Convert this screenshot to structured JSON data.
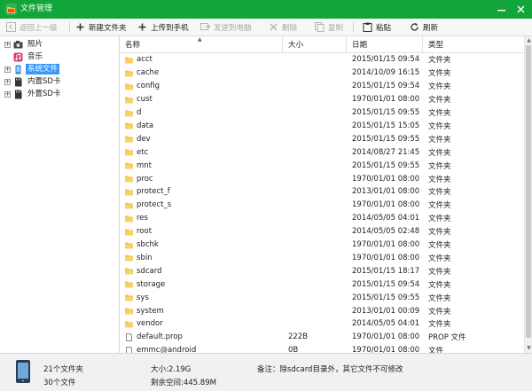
{
  "window": {
    "title": "文件管理",
    "accent": "#12a53a",
    "controls": [
      "minimize",
      "close"
    ]
  },
  "toolbar": {
    "back": {
      "label": "返回上一级",
      "icon": "back-icon",
      "enabled": false
    },
    "new_folder": {
      "label": "新建文件夹",
      "icon": "plus-icon",
      "enabled": true
    },
    "upload": {
      "label": "上传到手机",
      "icon": "plus-icon",
      "enabled": true
    },
    "send_pc": {
      "label": "发送到电脑",
      "icon": "send-icon",
      "enabled": false
    },
    "delete": {
      "label": "删除",
      "icon": "close-icon",
      "enabled": false
    },
    "copy": {
      "label": "复制",
      "icon": "copy-icon",
      "enabled": false
    },
    "paste": {
      "label": "粘贴",
      "icon": "clipboard-icon",
      "enabled": true
    },
    "refresh": {
      "label": "刷新",
      "icon": "refresh-icon",
      "enabled": true
    }
  },
  "tree": [
    {
      "label": "照片",
      "icon": "camera-icon",
      "expander": true
    },
    {
      "label": "音乐",
      "icon": "music-icon",
      "expander": false
    },
    {
      "label": "系统文件",
      "icon": "phone-icon",
      "expander": true,
      "selected": true
    },
    {
      "label": "内置SD卡",
      "icon": "sdcard-icon",
      "expander": true
    },
    {
      "label": "外置SD卡",
      "icon": "sdcard-icon",
      "expander": true
    }
  ],
  "columns": {
    "name": "名称",
    "size": "大小",
    "date": "日期",
    "type": "类型"
  },
  "files": [
    {
      "name": "acct",
      "size": "",
      "date": "2015/01/15 09:54",
      "type": "文件夹",
      "kind": "folder"
    },
    {
      "name": "cache",
      "size": "",
      "date": "2014/10/09 16:15",
      "type": "文件夹",
      "kind": "folder"
    },
    {
      "name": "config",
      "size": "",
      "date": "2015/01/15 09:54",
      "type": "文件夹",
      "kind": "folder"
    },
    {
      "name": "cust",
      "size": "",
      "date": "1970/01/01 08:00",
      "type": "文件夹",
      "kind": "folder"
    },
    {
      "name": "d",
      "size": "",
      "date": "2015/01/15 09:55",
      "type": "文件夹",
      "kind": "folder"
    },
    {
      "name": "data",
      "size": "",
      "date": "2015/01/15 15:05",
      "type": "文件夹",
      "kind": "folder"
    },
    {
      "name": "dev",
      "size": "",
      "date": "2015/01/15 09:55",
      "type": "文件夹",
      "kind": "folder"
    },
    {
      "name": "etc",
      "size": "",
      "date": "2014/08/27 21:45",
      "type": "文件夹",
      "kind": "folder"
    },
    {
      "name": "mnt",
      "size": "",
      "date": "2015/01/15 09:55",
      "type": "文件夹",
      "kind": "folder"
    },
    {
      "name": "proc",
      "size": "",
      "date": "1970/01/01 08:00",
      "type": "文件夹",
      "kind": "folder"
    },
    {
      "name": "protect_f",
      "size": "",
      "date": "2013/01/01 08:00",
      "type": "文件夹",
      "kind": "folder"
    },
    {
      "name": "protect_s",
      "size": "",
      "date": "1970/01/01 08:00",
      "type": "文件夹",
      "kind": "folder"
    },
    {
      "name": "res",
      "size": "",
      "date": "2014/05/05 04:01",
      "type": "文件夹",
      "kind": "folder"
    },
    {
      "name": "root",
      "size": "",
      "date": "2014/05/05 02:48",
      "type": "文件夹",
      "kind": "folder"
    },
    {
      "name": "sbchk",
      "size": "",
      "date": "1970/01/01 08:00",
      "type": "文件夹",
      "kind": "folder"
    },
    {
      "name": "sbin",
      "size": "",
      "date": "1970/01/01 08:00",
      "type": "文件夹",
      "kind": "folder"
    },
    {
      "name": "sdcard",
      "size": "",
      "date": "2015/01/15 18:17",
      "type": "文件夹",
      "kind": "folder"
    },
    {
      "name": "storage",
      "size": "",
      "date": "2015/01/15 09:54",
      "type": "文件夹",
      "kind": "folder"
    },
    {
      "name": "sys",
      "size": "",
      "date": "2015/01/15 09:55",
      "type": "文件夹",
      "kind": "folder"
    },
    {
      "name": "system",
      "size": "",
      "date": "2013/01/01 00:09",
      "type": "文件夹",
      "kind": "folder"
    },
    {
      "name": "vendor",
      "size": "",
      "date": "2014/05/05 04:01",
      "type": "文件夹",
      "kind": "folder"
    },
    {
      "name": "default.prop",
      "size": "222B",
      "date": "1970/01/01 08:00",
      "type": "PROP 文件",
      "kind": "file"
    },
    {
      "name": "emmc@android",
      "size": "0B",
      "date": "1970/01/01 08:00",
      "type": "文件",
      "kind": "file"
    }
  ],
  "status": {
    "folder_count": "21个文件夹",
    "file_count": "30个文件",
    "total_size": "大小:2.19G",
    "free_space": "剩余空间:445.89M",
    "note": "备注：除sdcard目录外，其它文件不可修改"
  },
  "colors": {
    "selection": "#3399ff",
    "folder": "#f2c54b",
    "disabled_text": "#a8a8a8"
  }
}
